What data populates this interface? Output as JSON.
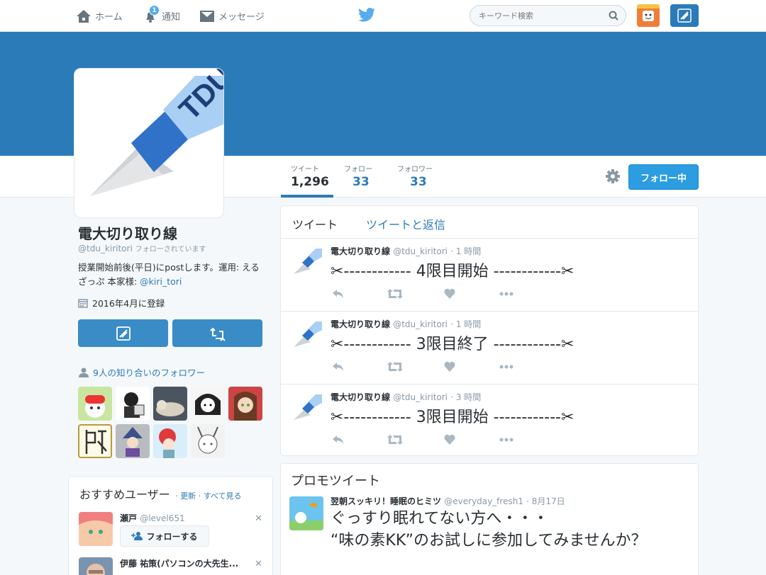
{
  "nav": {
    "home": "ホーム",
    "notifications": "通知",
    "notif_badge": "1",
    "messages": "メッセージ",
    "search_placeholder": "キーワード検索"
  },
  "colors": {
    "brand": "#2b7bb9",
    "accent": "#55acee",
    "banner": "#2b7bb9"
  },
  "stats": [
    {
      "label": "ツイート",
      "value": "1,296"
    },
    {
      "label": "フォロー",
      "value": "33"
    },
    {
      "label": "フォロワー",
      "value": "33"
    }
  ],
  "follow_button": "フォロー中",
  "profile": {
    "name": "電大切り取り線",
    "handle": "@tdu_kiritori",
    "follows_you": "フォローされています",
    "bio": "授業開始前後(平日)にpostします。運用: えるざっぷ 本家様: ",
    "bio_link": "@kiri_tori",
    "joined": "2016年4月に登録",
    "avatar_text": "TDU"
  },
  "followers_you_know": "9人の知り合いのフォロワー",
  "recommend": {
    "title": "おすすめユーザー",
    "refresh": "更新",
    "view_all": "すべて見る",
    "users": [
      {
        "name": "瀬戸",
        "handle": "@level651",
        "follow": "フォローする"
      },
      {
        "name": "伊藤 祐策(パソコンの大先生...",
        "handle": ""
      }
    ]
  },
  "timeline": {
    "tabs": [
      "ツイート",
      "ツイートと返信"
    ],
    "tweets": [
      {
        "name": "電大切り取り線",
        "handle": "@tdu_kiritori",
        "time": "· 1 時間",
        "text": "✂------------ 4限目開始 ------------✂"
      },
      {
        "name": "電大切り取り線",
        "handle": "@tdu_kiritori",
        "time": "· 1 時間",
        "text": "✂------------ 3限目終了 ------------✂"
      },
      {
        "name": "電大切り取り線",
        "handle": "@tdu_kiritori",
        "time": "· 3 時間",
        "text": "✂------------ 3限目開始 ------------✂"
      }
    ]
  },
  "promo": {
    "title": "プロモツイート",
    "name": "翌朝スッキリ！睡眠のヒミツ",
    "handle": "@everyday_fresh1",
    "date": "· 8月17日",
    "text": "ぐっすり眠れてない方へ・・・\n“味の素KK”のお試しに参加してみませんか？"
  }
}
